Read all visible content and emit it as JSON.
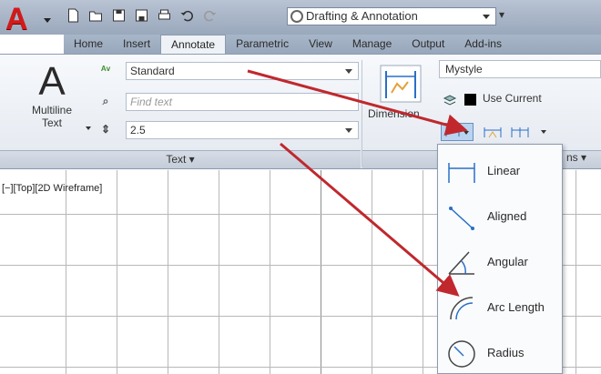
{
  "app": {
    "logo_letter": "A"
  },
  "quick_access": {
    "workspace_value": "Drafting & Annotation",
    "icons": [
      "new-icon",
      "open-icon",
      "save-icon",
      "save-as-icon",
      "plot-icon",
      "undo-icon",
      "redo-icon"
    ]
  },
  "ribbon_tabs": [
    "Home",
    "Insert",
    "Annotate",
    "Parametric",
    "View",
    "Manage",
    "Output",
    "Add-ins"
  ],
  "active_tab": "Annotate",
  "text_panel": {
    "multiline_line1": "Multiline",
    "multiline_line2": "Text",
    "text_style": "Standard",
    "find_placeholder": "Find text",
    "text_height": "2.5",
    "panel_title": "Text ▾"
  },
  "dimension_panel": {
    "big_label": "Dimension",
    "dim_style": "Mystyle",
    "layer_label": "Use Current",
    "panel_title_partial": "ns ▾"
  },
  "viewport": {
    "label": "[−][Top][2D Wireframe]"
  },
  "dim_dropdown": {
    "items": [
      "Linear",
      "Aligned",
      "Angular",
      "Arc Length",
      "Radius"
    ]
  },
  "colors": {
    "arrow": "#c0282e",
    "autocad_red": "#d11a1a",
    "ribbon_blue": "#98a7bb",
    "selected_button": "#b9d4f1"
  }
}
